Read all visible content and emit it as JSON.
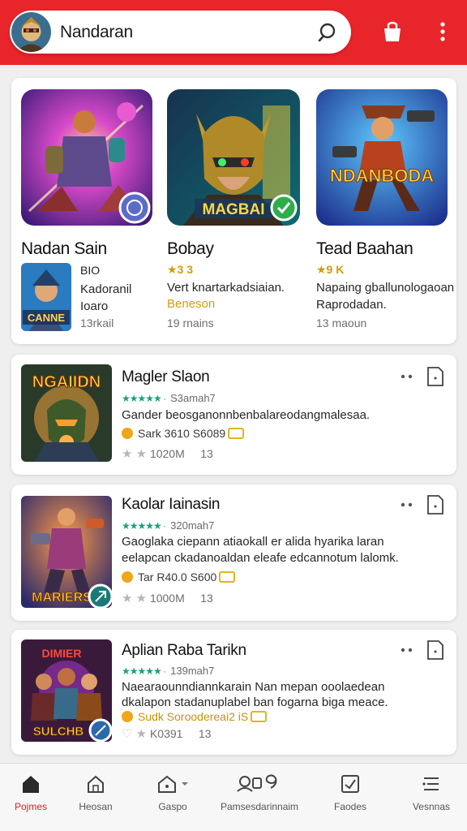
{
  "search": {
    "value": "Nandaran",
    "accent": "#e8252b"
  },
  "featured": [
    {
      "title": "Nadan Sain",
      "art": "purple-robot-heroes"
    },
    {
      "title": "Bobay",
      "badge_text": "MAGBAI",
      "art": "golden-helmet-hero"
    },
    {
      "title": "Tead Baahan",
      "badge_text": "NDANBODA",
      "art": "cowboy-hero"
    }
  ],
  "featured_detail": {
    "thumb_text": "CANNE",
    "col1": {
      "line1": "BIO",
      "line2": "Kadoranil",
      "line3": "Ioaro",
      "meta": "13rkail"
    },
    "col2": {
      "rating": "★3 3",
      "desc": "Vert knartarkadsiaian.",
      "link": "Beneson",
      "meta": "19 rnains"
    },
    "col3": {
      "rating": "★9 K",
      "desc_line1": "Napaing gballunologaoan",
      "desc_line2": "Raprodadan.",
      "meta": "13 maoun"
    }
  },
  "list": [
    {
      "thumb_text": "NGAIIDN",
      "title": "Magler Slaon",
      "stars": "★★★★★ ·",
      "reviews": "S3amah7",
      "desc": [
        "Gander beosganonnbenbalareodangmalesaa."
      ],
      "price": "Sark 3610 S6089",
      "stat1": "1020M",
      "stat2": "13"
    },
    {
      "thumb_text": "MARIERS",
      "title": "Kaolar Iainasin",
      "stars": "★★★★★ ·",
      "reviews": "320mah7",
      "desc": [
        "Gaoglaka ciepann atiaokall er alida hyarika laran",
        "eelapcan ckadanoaldan eleafe edcannotum lalomk."
      ],
      "price": "Tar R40.0 S600",
      "stat1": "1000M",
      "stat2": "13"
    },
    {
      "thumb_text": "SULCHB",
      "title": "Aplian Raba Tarikn",
      "stars": "★★★★★ ·",
      "reviews": "139mah7",
      "desc": [
        "Naearaounndiannkarain Nan mepan ooolaedean",
        "dkalapon stadanuplabel ban fogarna biga meace."
      ],
      "price": "Sudk Soroodereai2 iS",
      "stat1": "K0391",
      "stat2": "13"
    }
  ],
  "bottom_nav": [
    {
      "label": "Pojmes",
      "icon": "home-icon",
      "active": true
    },
    {
      "label": "Heosan",
      "icon": "house-outline-icon",
      "active": false
    },
    {
      "label": "Gaspo",
      "icon": "store-icon",
      "active": false
    },
    {
      "label": "Pamsesdarinnaim",
      "icon": "people-icon",
      "active": false
    },
    {
      "label": "Faodes",
      "icon": "inbox-icon",
      "active": false
    },
    {
      "label": "Vesnnas",
      "icon": "list-icon",
      "active": false
    }
  ]
}
